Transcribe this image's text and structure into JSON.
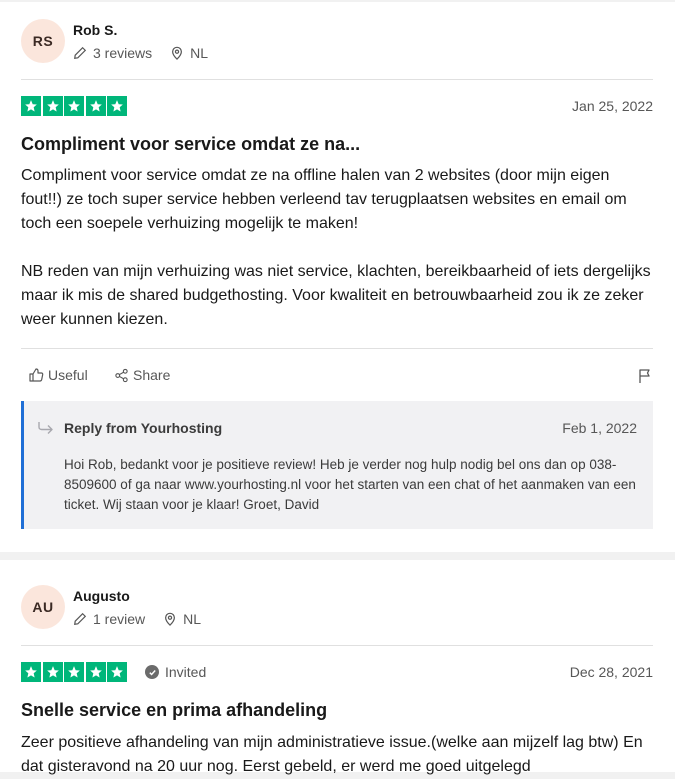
{
  "reviews": [
    {
      "initials": "RS",
      "name": "Rob S.",
      "review_count": "3 reviews",
      "country": "NL",
      "rating": 5,
      "date": "Jan 25, 2022",
      "title": "Compliment voor service omdat ze na...",
      "body": [
        "Compliment voor service omdat ze na offline halen van 2 websites (door mijn eigen fout!!) ze toch super service hebben verleend tav terugplaatsen websites en email om toch een soepele verhuizing mogelijk te maken!",
        "NB reden van mijn verhuizing was niet service, klachten, bereikbaarheid of iets dergelijks maar ik mis de shared budgethosting. Voor kwaliteit en betrouwbaarheid zou ik ze zeker weer kunnen kiezen."
      ],
      "useful_label": "Useful",
      "share_label": "Share",
      "reply": {
        "title": "Reply from Yourhosting",
        "date": "Feb 1, 2022",
        "body": "Hoi Rob, bedankt voor je positieve review! Heb je verder nog hulp nodig bel ons dan op 038-8509600 of ga naar www.yourhosting.nl voor het starten van een chat of het aanmaken van een ticket. Wij staan voor je klaar! Groet, David"
      }
    },
    {
      "initials": "AU",
      "name": "Augusto",
      "review_count": "1 review",
      "country": "NL",
      "rating": 5,
      "invited_label": "Invited",
      "date": "Dec 28, 2021",
      "title": "Snelle service en prima afhandeling",
      "body": [
        "Zeer positieve afhandeling van mijn administratieve issue.(welke aan mijzelf lag btw) En dat gisteravond na 20 uur nog. Eerst gebeld, er werd me goed uitgelegd"
      ]
    }
  ],
  "colors": {
    "star_green": "#00b67a",
    "reply_border": "#1f6fd6",
    "avatar_bg": "#fbe6dc"
  }
}
